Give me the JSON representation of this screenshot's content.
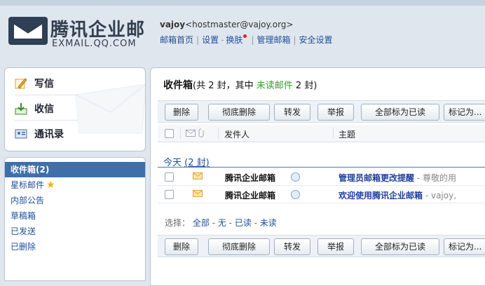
{
  "brand": {
    "cn": "腾讯企业邮",
    "en": "EXMAIL.QQ.COM"
  },
  "user": {
    "name": "vajoy",
    "email": "<hostmaster@vajoy.org>"
  },
  "toplinks": [
    "邮箱首页",
    "设置",
    "换肤",
    "管理邮箱",
    "安全设置"
  ],
  "compose": {
    "write": "写信",
    "receive": "收信",
    "contacts": "通讯录"
  },
  "folders": [
    {
      "label": "收件箱(2)",
      "active": true
    },
    {
      "label": "星标邮件"
    },
    {
      "label": "内部公告"
    },
    {
      "label": "草稿箱"
    },
    {
      "label": "已发送"
    },
    {
      "label": "已删除"
    }
  ],
  "inbox": {
    "title": "收件箱",
    "count_prefix": "(共 2 封，其中 ",
    "unread_label": "未读邮件",
    "count_suffix": " 2 封)"
  },
  "toolbar": {
    "delete": "删除",
    "delete_forever": "彻底删除",
    "forward": "转发",
    "report": "举报",
    "mark_all_read": "全部标为已读",
    "mark_as": "标记为..."
  },
  "columns": {
    "sender": "发件人",
    "subject": "主题"
  },
  "group": {
    "label": "今天",
    "count": "(2 封)"
  },
  "messages": [
    {
      "sender": "腾讯企业邮箱",
      "subject": "管理员邮箱更改提醒",
      "preview": " - 尊敬的用"
    },
    {
      "sender": "腾讯企业邮箱",
      "subject": "欢迎使用腾讯企业邮箱",
      "preview": " - vajoy,"
    }
  ],
  "selection": {
    "label": "选择：",
    "all": "全部",
    "none": "无",
    "read": "已读",
    "unread": "未读"
  },
  "colors": {
    "accent": "#3e6fa8",
    "link": "#1f4f9b",
    "unread_green": "#3a9b2c"
  }
}
